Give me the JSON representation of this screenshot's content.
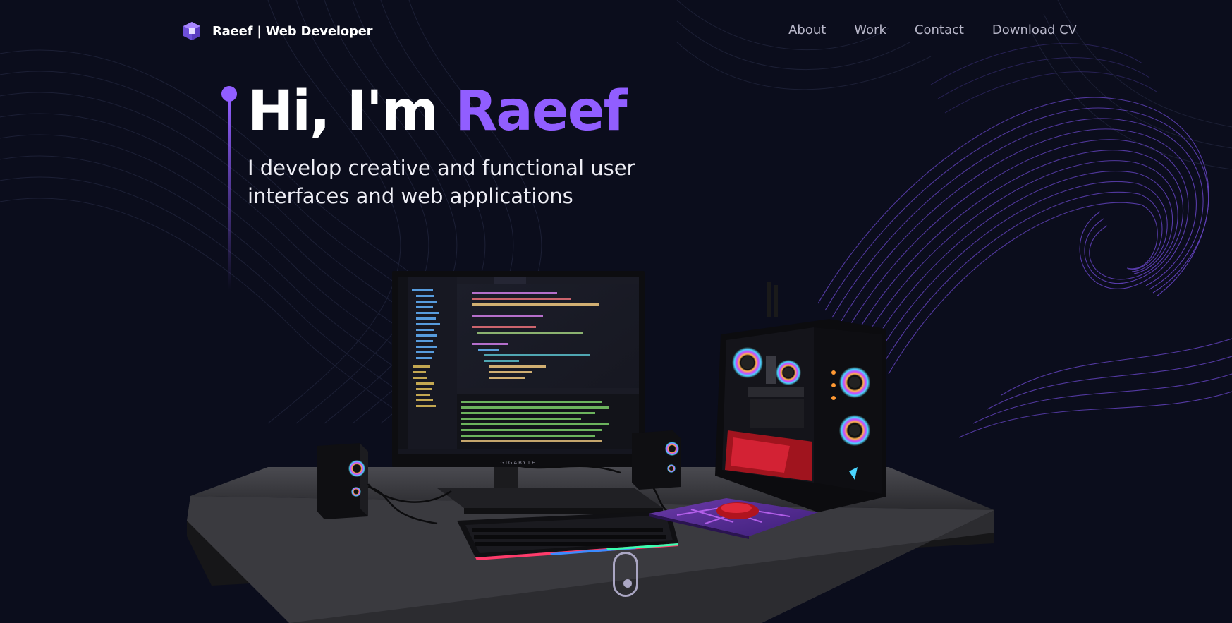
{
  "nav": {
    "brand": "Raeef | Web Developer",
    "brand_icon": "cube-logo-icon",
    "links": [
      "About",
      "Work",
      "Contact",
      "Download CV"
    ]
  },
  "hero": {
    "title_prefix": "Hi, I'm ",
    "title_name": "Raeef",
    "subtitle": "I develop creative and functional user interfaces and web applications"
  },
  "scene": {
    "description_icon": "desk-setup-3d",
    "monitor_brand": "GIGABYTE"
  },
  "scroll_indicator": "mouse-scroll-icon",
  "colors": {
    "background": "#0b0d1c",
    "accent": "#915eff",
    "nav_text": "#b8b7c9",
    "text": "#ffffff"
  }
}
